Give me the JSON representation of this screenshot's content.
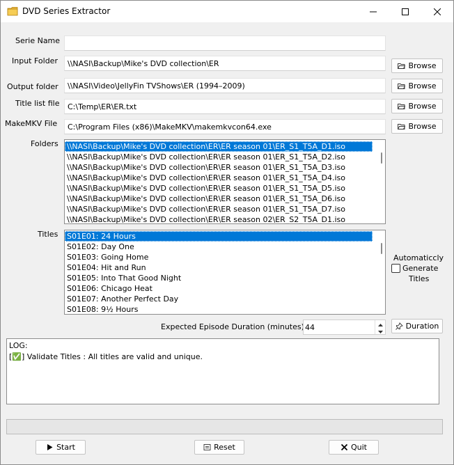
{
  "window": {
    "title": "DVD Series Extractor"
  },
  "form": {
    "serie_name_label": "Serie Name",
    "serie_name_value": "",
    "input_folder_label": "Input Folder",
    "input_folder_value": "\\\\NASI\\Backup\\Mike's DVD collection\\ER",
    "output_folder_label": "Output folder",
    "output_folder_value": "\\\\NASI\\Video\\JellyFin TVShows\\ER (1994–2009)",
    "title_list_label": "Title list file",
    "title_list_value": "C:\\Temp\\ER\\ER.txt",
    "makemkv_label": "MakeMKV File",
    "makemkv_value": "C:\\Program Files (x86)\\MakeMKV\\makemkvcon64.exe",
    "browse_label": "Browse"
  },
  "folders": {
    "label": "Folders",
    "items": [
      "\\\\NASI\\Backup\\Mike's DVD collection\\ER\\ER season 01\\ER_S1_T5A_D1.iso",
      "\\\\NASI\\Backup\\Mike's DVD collection\\ER\\ER season 01\\ER_S1_T5A_D2.iso",
      "\\\\NASI\\Backup\\Mike's DVD collection\\ER\\ER season 01\\ER_S1_T5A_D3.iso",
      "\\\\NASI\\Backup\\Mike's DVD collection\\ER\\ER season 01\\ER_S1_T5A_D4.iso",
      "\\\\NASI\\Backup\\Mike's DVD collection\\ER\\ER season 01\\ER_S1_T5A_D5.iso",
      "\\\\NASI\\Backup\\Mike's DVD collection\\ER\\ER season 01\\ER_S1_T5A_D6.iso",
      "\\\\NASI\\Backup\\Mike's DVD collection\\ER\\ER season 01\\ER_S1_T5A_D7.iso",
      "\\\\NASI\\Backup\\Mike's DVD collection\\ER\\ER season 02\\ER_S2_T5A_D1.iso"
    ]
  },
  "titles": {
    "label": "Titles",
    "items": [
      "S01E01: 24 Hours",
      "S01E02: Day One",
      "S01E03: Going Home",
      "S01E04: Hit and Run",
      "S01E05: Into That Good Night",
      "S01E06: Chicago Heat",
      "S01E07: Another Perfect Day",
      "S01E08: 9½ Hours"
    ],
    "auto_label_1": "Automaticcly",
    "auto_label_2": "Generate",
    "auto_label_3": "Titles"
  },
  "duration": {
    "label": "Expected Episode Duration (minutes)",
    "value": "44",
    "button_label": "Duration"
  },
  "log": {
    "lines": [
      "LOG:",
      "[✅] Validate Titles : All titles are valid and unique."
    ]
  },
  "progress": {
    "value": 0
  },
  "footer": {
    "start_label": "Start",
    "reset_label": "Reset",
    "quit_label": "Quit"
  },
  "colors": {
    "selection": "#0078d7",
    "progress_fill": "#06b025"
  }
}
